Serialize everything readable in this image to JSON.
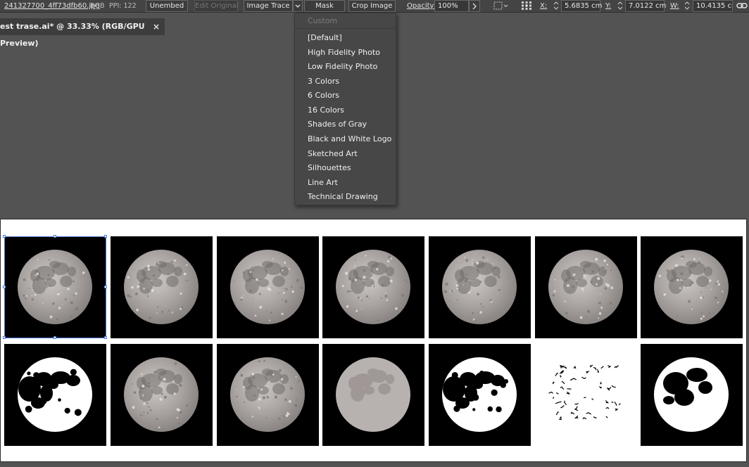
{
  "control_bar": {
    "filename": "241327700_4ff73dfb60.jpg",
    "color_mode": "RGB",
    "ppi": "PPI: 122",
    "unembed": "Unembed",
    "edit_original": "Edit Original",
    "image_trace": "Image Trace",
    "mask": "Mask",
    "crop_image": "Crop Image",
    "opacity_label": "Opacity:",
    "opacity_value": "100%",
    "x_label": "X:",
    "x_value": "5.6835 cm",
    "y_label": "Y:",
    "y_value": "7.0122 cm",
    "w_label": "W:",
    "w_value": "10.4135 cm",
    "icons": [
      "chevron-down-icon",
      "chevron-right-icon",
      "align-grid-icon",
      "reference-point-icon",
      "stepper-icon",
      "link-icon"
    ]
  },
  "document_tab": {
    "title": "est trase.ai* @ 33.33% (RGB/GPU Preview)",
    "close": "×"
  },
  "trace_presets_menu": {
    "header": "Custom",
    "items": [
      "[Default]",
      "High Fidelity Photo",
      "Low Fidelity Photo",
      "3 Colors",
      "6 Colors",
      "16 Colors",
      "Shades of Gray",
      "Black and White Logo",
      "Sketched Art",
      "Silhouettes",
      "Line Art",
      "Technical Drawing"
    ]
  },
  "artboard": {
    "row1": [
      "moon-photo",
      "moon-photo",
      "moon-photo",
      "moon-photo",
      "moon-photo",
      "moon-photo",
      "moon-photo"
    ],
    "row2": [
      "moon-black-white",
      "moon-photo",
      "moon-photo",
      "moon-gray",
      "moon-black-white",
      "moon-line-art",
      "moon-silhouette"
    ]
  },
  "colors": {
    "workspace": "#535353",
    "panel": "#444444",
    "selection": "#4a7bd8"
  }
}
